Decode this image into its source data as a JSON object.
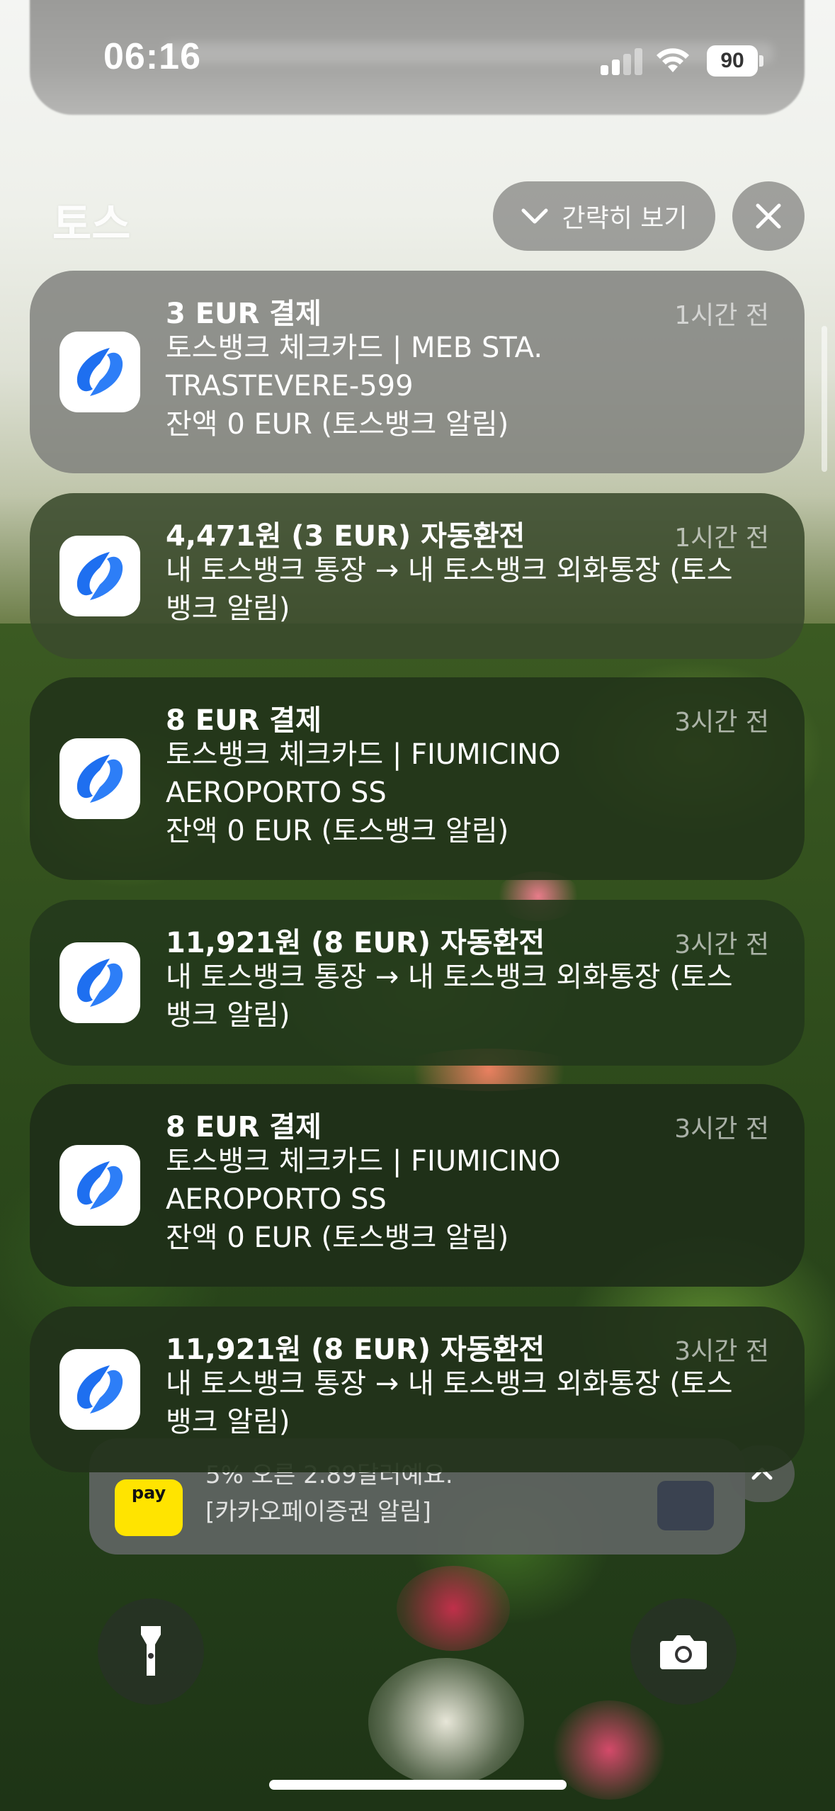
{
  "status_bar": {
    "time": "06:16",
    "battery": "90"
  },
  "group": {
    "title": "토스",
    "collapse_label": "간략히 보기"
  },
  "notifications": [
    {
      "title": "3 EUR 결제",
      "time": "1시간 전",
      "body": "토스뱅크 체크카드 | MEB STA.\nTRASTEVERE-599\n잔액 0 EUR (토스뱅크 알림)"
    },
    {
      "title": "4,471원 (3 EUR) 자동환전",
      "time": "1시간 전",
      "body": "내 토스뱅크 통장 → 내 토스뱅크 외화통장 (토스\n뱅크 알림)"
    },
    {
      "title": "8 EUR 결제",
      "time": "3시간 전",
      "body": "토스뱅크 체크카드 | FIUMICINO\nAEROPORTO SS\n잔액 0 EUR (토스뱅크 알림)"
    },
    {
      "title": "11,921원 (8 EUR) 자동환전",
      "time": "3시간 전",
      "body": "내 토스뱅크 통장 → 내 토스뱅크 외화통장 (토스\n뱅크 알림)"
    },
    {
      "title": "8 EUR 결제",
      "time": "3시간 전",
      "body": "토스뱅크 체크카드 | FIUMICINO\nAEROPORTO SS\n잔액 0 EUR (토스뱅크 알림)"
    },
    {
      "title": "11,921원 (8 EUR) 자동환전",
      "time": "3시간 전",
      "body": "내 토스뱅크 통장 → 내 토스뱅크 외화통장 (토스\n뱅크 알림)"
    }
  ],
  "kakao_notification": {
    "app_badge": "pay",
    "line1": "5% 오른 2.89달러예요.",
    "line2": "[카카오페이증권 알림]"
  },
  "lock_controls": {
    "left": "flashlight-icon",
    "right": "camera-icon"
  }
}
